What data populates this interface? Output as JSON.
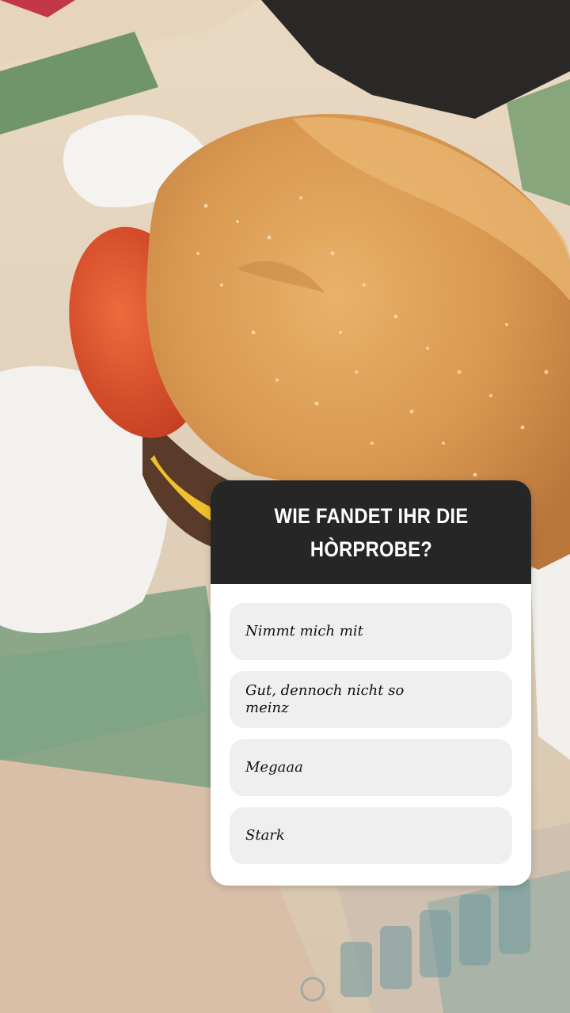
{
  "story": {
    "background": "burger-photo",
    "quiz": {
      "question": "WIE FANDET IHR DIE HÒRPROBE?",
      "options": [
        {
          "label": "Nimmt mich mit"
        },
        {
          "label": "Gut, dennoch nicht so meinz"
        },
        {
          "label": "Megaaa"
        },
        {
          "label": "Stark"
        }
      ]
    }
  },
  "colors": {
    "header_bg": "#262626",
    "option_bg": "#efefef",
    "card_bg": "#ffffff",
    "bun": "#e2a85e",
    "tomato": "#d9482a"
  }
}
